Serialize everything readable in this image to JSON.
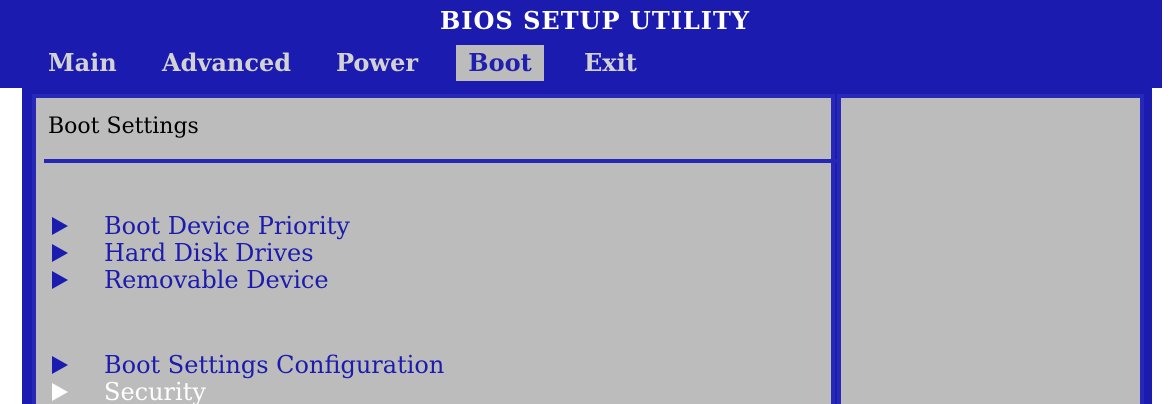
{
  "title": "BIOS SETUP UTILITY",
  "tabs": [
    {
      "label": "Main"
    },
    {
      "label": "Advanced"
    },
    {
      "label": "Power"
    },
    {
      "label": "Boot",
      "active": true
    },
    {
      "label": "Exit"
    }
  ],
  "section_title": "Boot Settings",
  "menu_items": [
    {
      "label": "Boot Device Priority"
    },
    {
      "label": "Hard Disk Drives"
    },
    {
      "label": "Removable Device"
    },
    {
      "label": "Boot Settings Configuration"
    },
    {
      "label": "Security",
      "selected": true
    }
  ],
  "colors": {
    "header_blue": "#1b1bb0",
    "panel_gray": "#bcbcbc",
    "item_blue": "#1b1bb0",
    "selected_white": "#ffffff"
  },
  "icons": {
    "menu_arrow": "right-triangle-icon"
  }
}
